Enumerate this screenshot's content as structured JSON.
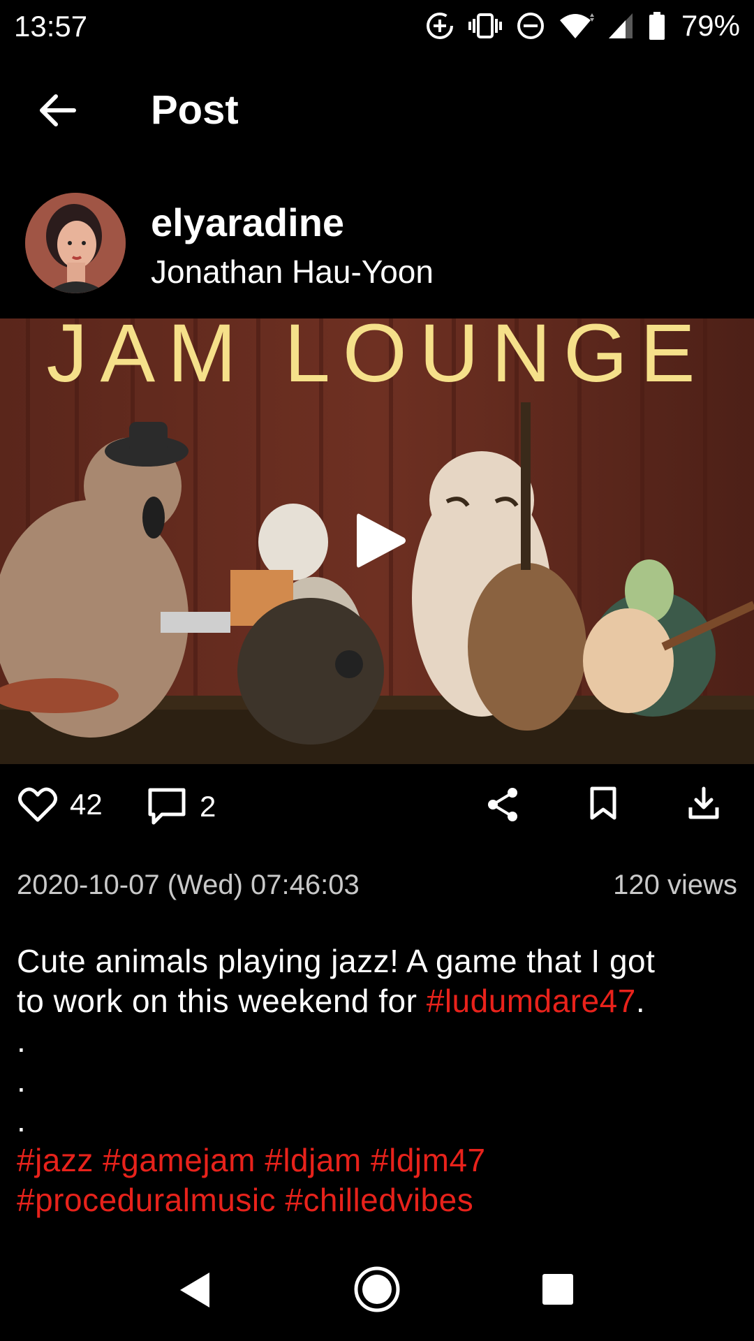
{
  "status": {
    "time": "13:57",
    "battery": "79%"
  },
  "header": {
    "title": "Post"
  },
  "author": {
    "username": "elyaradine",
    "name": "Jonathan Hau-Yoon"
  },
  "media": {
    "sign_text": "JAM LOUNGE"
  },
  "actions": {
    "likes": "42",
    "comments": "2"
  },
  "meta": {
    "datetime": "2020-10-07 (Wed) 07:46:03",
    "views": "120 views"
  },
  "caption": {
    "line1": "Cute animals playing jazz! A game that I got",
    "line2_prefix": "to work on this weekend for ",
    "line2_tag": "#ludumdare47",
    "line2_suffix": ".",
    "dots": [
      ".",
      ".",
      "."
    ],
    "hashtags": [
      "#jazz",
      "#gamejam",
      "#ldjam",
      "#ldjm47",
      "#proceduralmusic",
      "#chilledvibes"
    ]
  },
  "colors": {
    "accent": "#e8221b",
    "background": "#000000"
  }
}
